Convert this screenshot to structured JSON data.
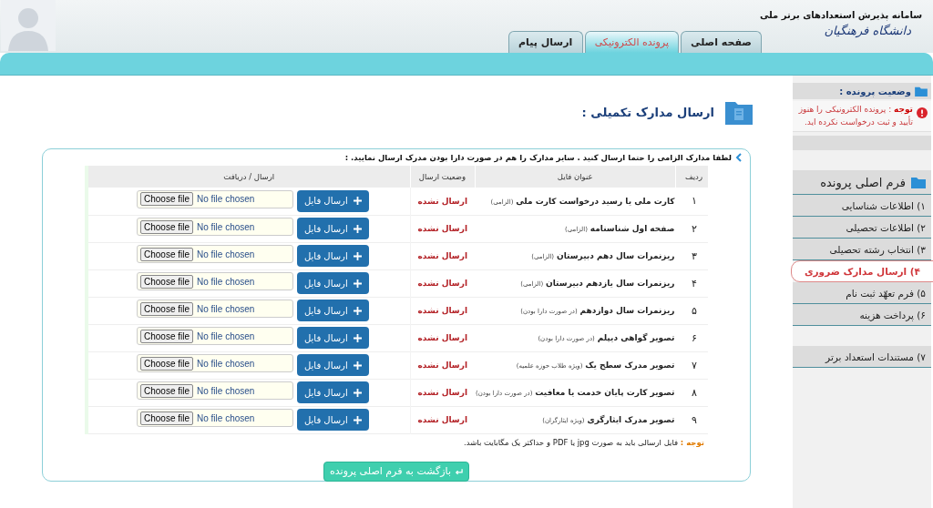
{
  "header": {
    "site_title": "سامانه پذیرش استعدادهای برتر ملی",
    "university": "دانشگاه فرهنگیان"
  },
  "tabs": [
    {
      "label": "صفحه اصلی",
      "selected": false
    },
    {
      "label": "پرونده الکترونیکی",
      "selected": true
    },
    {
      "label": "ارسال پیام",
      "selected": false
    }
  ],
  "sidebar": {
    "status_title": "وضعیت پرونده :",
    "status_alert": "**توجه** : پرونده الکترونیکی را هنوز تأیید و ثبت درخواست نکرده اید.",
    "menu_title": "فرم اصلی پرونده",
    "items": [
      {
        "label": "۱) اطلاعات شناسایی",
        "selected": false
      },
      {
        "label": "۲) اطلاعات تحصیلی",
        "selected": false
      },
      {
        "label": "۳) انتخاب رشته تحصیلی",
        "selected": false
      },
      {
        "label": "۴) ارسال مدارک ضروری",
        "selected": true
      },
      {
        "label": "۵) فرم تعهّد ثبت نام",
        "selected": false
      },
      {
        "label": "۶) پرداخت هزینه",
        "selected": false
      }
    ],
    "extra_items": [
      {
        "label": "۷) مستندات استعداد برتر",
        "selected": false
      }
    ]
  },
  "page_title": "ارسال مدارک تکمیلی :",
  "instructions": "لطفا مدارک الزامی را حتما ارسال کنید . سایر مدارک را هم در صورت دارا بودن مدرک ارسال نمایید. :",
  "table": {
    "columns": [
      "ردیف",
      "عنوان فایل",
      "وضعیت ارسال",
      "ارسال / دریافت"
    ],
    "rows": [
      {
        "number": "۱",
        "title": "کارت ملی یا رسید درخواست کارت ملی",
        "note": "(الزامی)",
        "status": "ارسال نشده",
        "choose": "Choose file",
        "file": "No file chosen",
        "button": "ارسال فایل"
      },
      {
        "number": "۲",
        "title": "صفحه اول شناسنامه",
        "note": "(الزامی)",
        "status": "ارسال نشده",
        "choose": "Choose file",
        "file": "No file chosen",
        "button": "ارسال فایل"
      },
      {
        "number": "۳",
        "title": "ریزنمرات سال دهم دبیرستان",
        "note": "(الزامی)",
        "status": "ارسال نشده",
        "choose": "Choose file",
        "file": "No file chosen",
        "button": "ارسال فایل"
      },
      {
        "number": "۴",
        "title": "ریزنمرات سال یازدهم دبیرستان",
        "note": "(الزامی)",
        "status": "ارسال نشده",
        "choose": "Choose file",
        "file": "No file chosen",
        "button": "ارسال فایل"
      },
      {
        "number": "۵",
        "title": "ریزنمرات سال دوازدهم",
        "note": "(در صورت دارا بودن)",
        "status": "ارسال نشده",
        "choose": "Choose file",
        "file": "No file chosen",
        "button": "ارسال فایل"
      },
      {
        "number": "۶",
        "title": "تصویر گواهی دیپلم",
        "note": "(در صورت دارا بودن)",
        "status": "ارسال نشده",
        "choose": "Choose file",
        "file": "No file chosen",
        "button": "ارسال فایل"
      },
      {
        "number": "۷",
        "title": "تصویر مدرک سطح یک",
        "note": "(ویژه طلاب حوزه علمیه)",
        "status": "ارسال نشده",
        "choose": "Choose file",
        "file": "No file chosen",
        "button": "ارسال فایل"
      },
      {
        "number": "۸",
        "title": "تصویر کارت پایان خدمت یا معافیت",
        "note": "(در صورت دارا بودن)",
        "status": "ارسال نشده",
        "choose": "Choose file",
        "file": "No file chosen",
        "button": "ارسال فایل"
      },
      {
        "number": "۹",
        "title": "تصویر مدرک ایثارگری",
        "note": "(ویژه ایثارگران)",
        "status": "ارسال نشده",
        "choose": "Choose file",
        "file": "No file chosen",
        "button": "ارسال فایل"
      }
    ]
  },
  "note_label": "توجه :",
  "note_text": "فایل ارسالی باید به صورت jpg یا PDF و حداکثر یک مگابایت باشد.",
  "back_button": "بازگشت به فرم اصلی پرونده"
}
